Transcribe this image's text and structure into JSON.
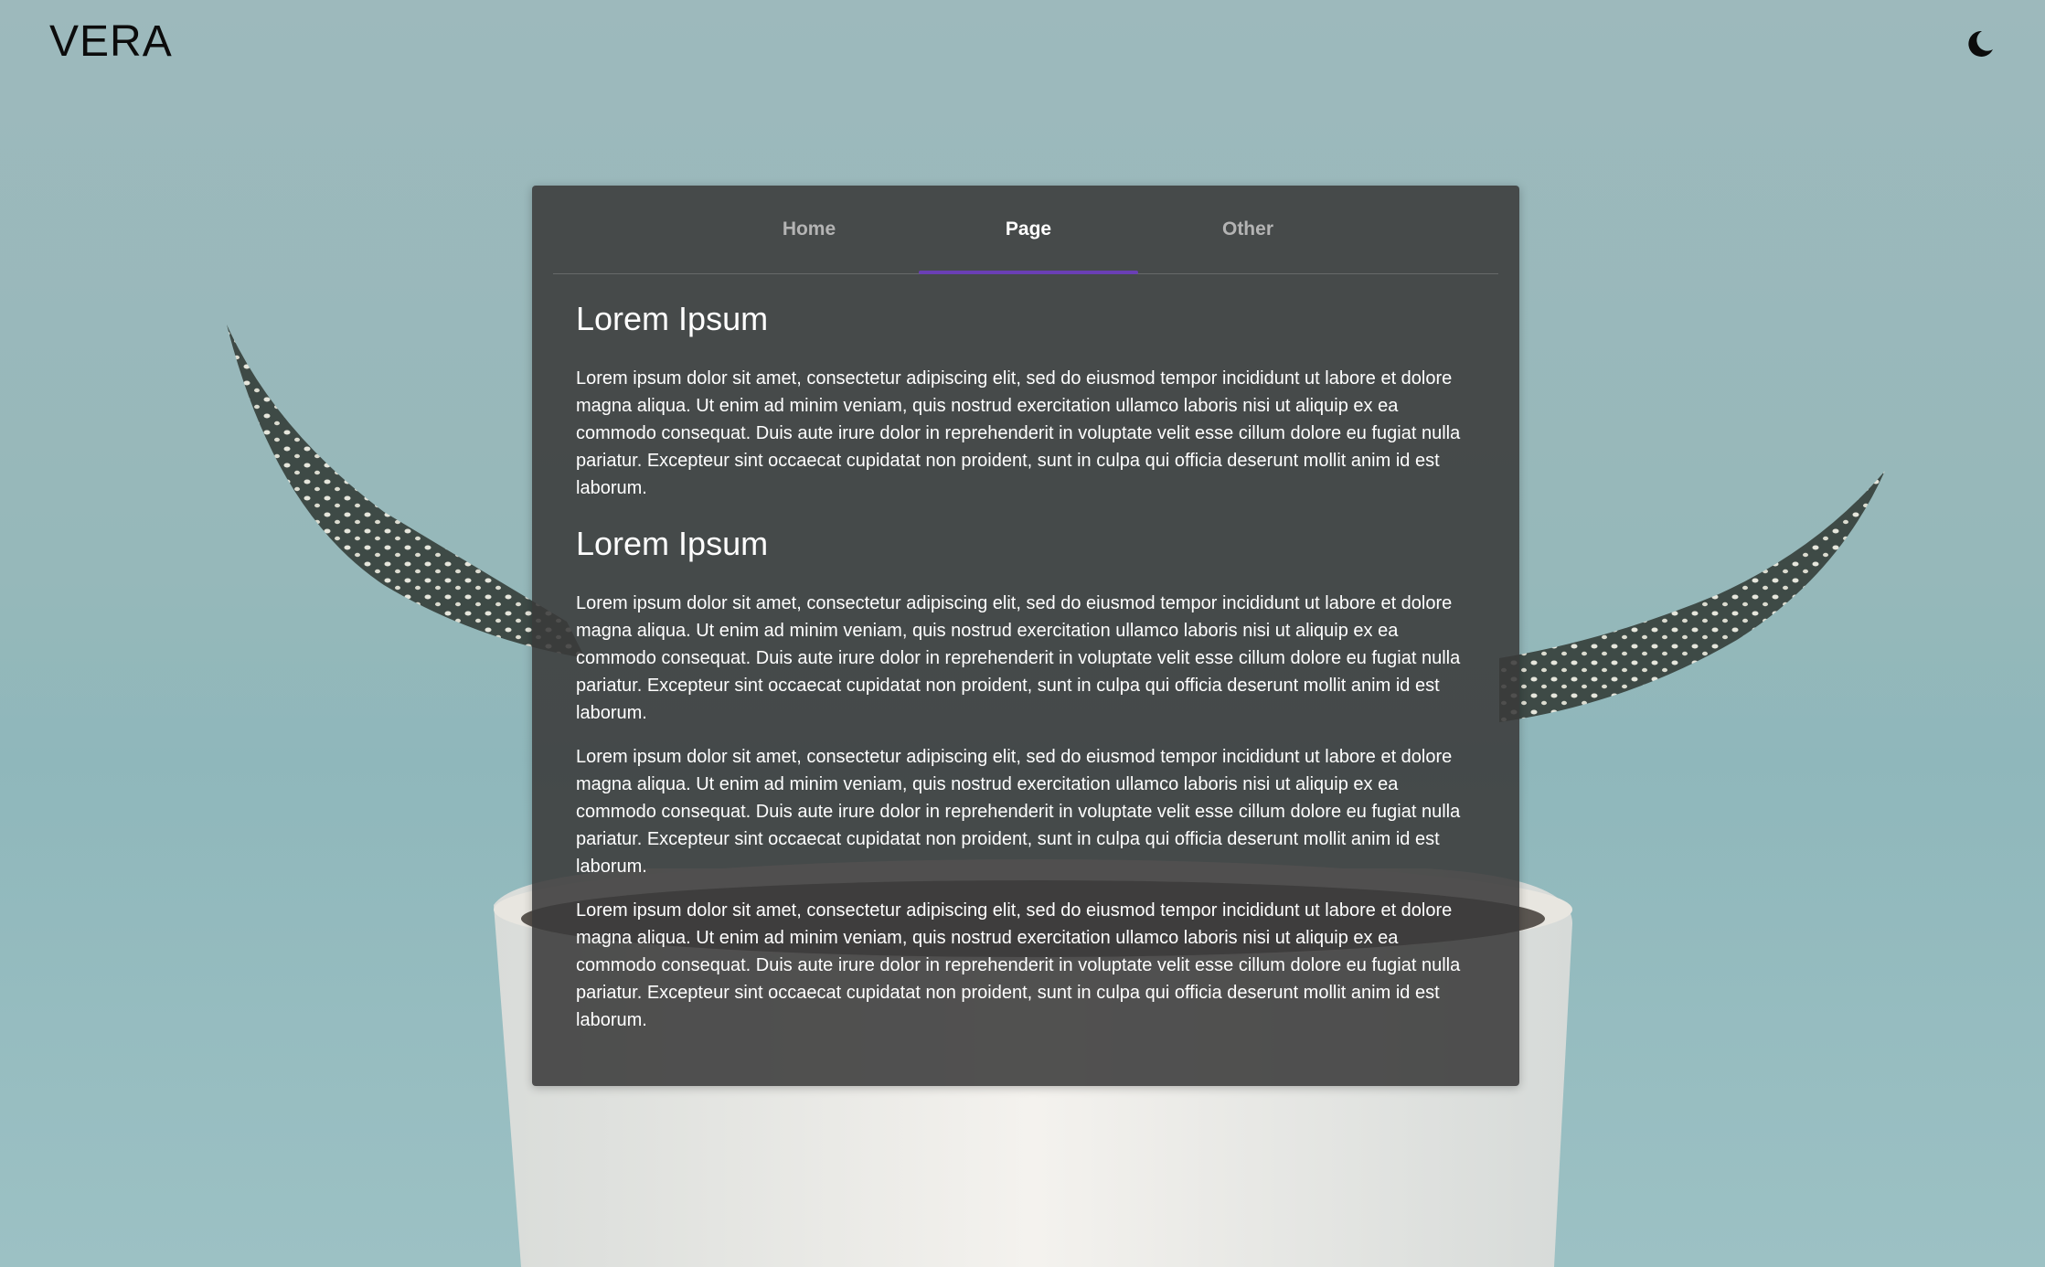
{
  "header": {
    "title": "VERA",
    "theme_toggle_icon": "moon-icon"
  },
  "colors": {
    "accent": "#6a3fb5",
    "card_background": "#3a3a3a",
    "page_background": "#96b8ba"
  },
  "nav": {
    "tabs": [
      {
        "label": "Home",
        "active": false
      },
      {
        "label": "Page",
        "active": true
      },
      {
        "label": "Other",
        "active": false
      }
    ]
  },
  "content": {
    "sections": [
      {
        "heading": "Lorem Ipsum",
        "paragraphs": [
          "Lorem ipsum dolor sit amet, consectetur adipiscing elit, sed do eiusmod tempor incididunt ut labore et dolore magna aliqua. Ut enim ad minim veniam, quis nostrud exercitation ullamco laboris nisi ut aliquip ex ea commodo consequat. Duis aute irure dolor in reprehenderit in voluptate velit esse cillum dolore eu fugiat nulla pariatur. Excepteur sint occaecat cupidatat non proident, sunt in culpa qui officia deserunt mollit anim id est laborum."
        ]
      },
      {
        "heading": "Lorem Ipsum",
        "paragraphs": [
          "Lorem ipsum dolor sit amet, consectetur adipiscing elit, sed do eiusmod tempor incididunt ut labore et dolore magna aliqua. Ut enim ad minim veniam, quis nostrud exercitation ullamco laboris nisi ut aliquip ex ea commodo consequat. Duis aute irure dolor in reprehenderit in voluptate velit esse cillum dolore eu fugiat nulla pariatur. Excepteur sint occaecat cupidatat non proident, sunt in culpa qui officia deserunt mollit anim id est laborum.",
          "Lorem ipsum dolor sit amet, consectetur adipiscing elit, sed do eiusmod tempor incididunt ut labore et dolore magna aliqua. Ut enim ad minim veniam, quis nostrud exercitation ullamco laboris nisi ut aliquip ex ea commodo consequat. Duis aute irure dolor in reprehenderit in voluptate velit esse cillum dolore eu fugiat nulla pariatur. Excepteur sint occaecat cupidatat non proident, sunt in culpa qui officia deserunt mollit anim id est laborum.",
          "Lorem ipsum dolor sit amet, consectetur adipiscing elit, sed do eiusmod tempor incididunt ut labore et dolore magna aliqua. Ut enim ad minim veniam, quis nostrud exercitation ullamco laboris nisi ut aliquip ex ea commodo consequat. Duis aute irure dolor in reprehenderit in voluptate velit esse cillum dolore eu fugiat nulla pariatur. Excepteur sint occaecat cupidatat non proident, sunt in culpa qui officia deserunt mollit anim id est laborum."
        ]
      }
    ]
  }
}
